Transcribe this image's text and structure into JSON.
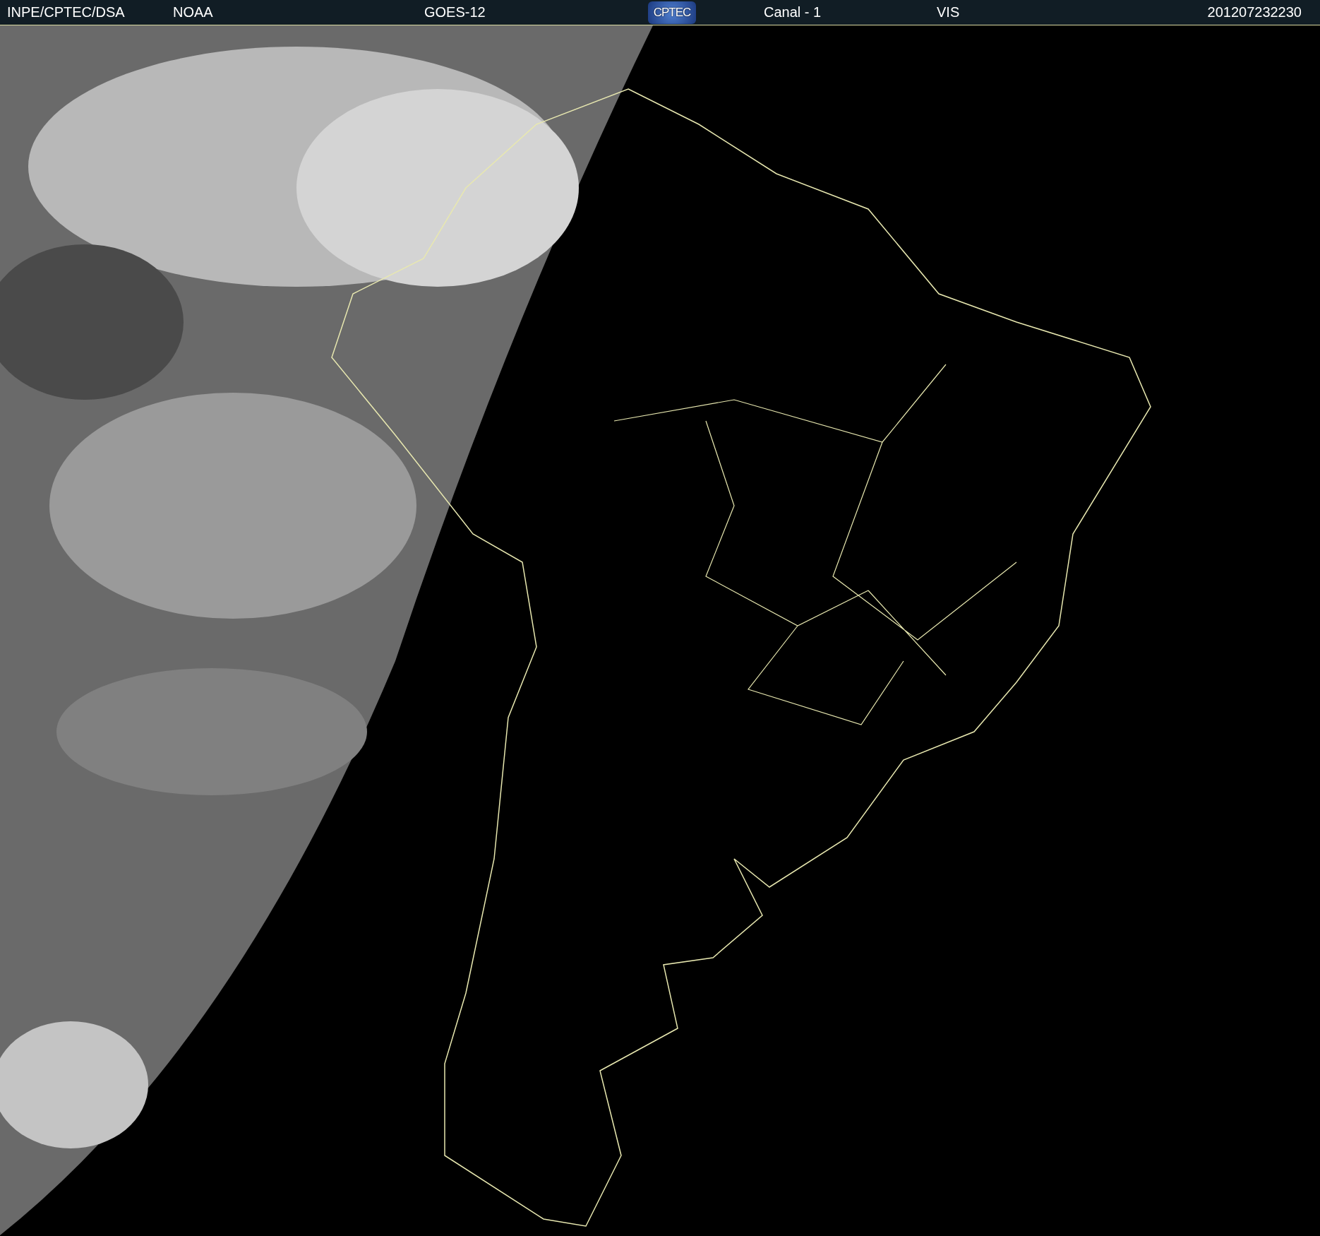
{
  "header": {
    "source": "INPE/CPTEC/DSA",
    "agency": "NOAA",
    "satellite": "GOES-12",
    "logo": "CPTEC",
    "channel": "Canal - 1",
    "band": "VIS",
    "timestamp": "201207232230"
  }
}
